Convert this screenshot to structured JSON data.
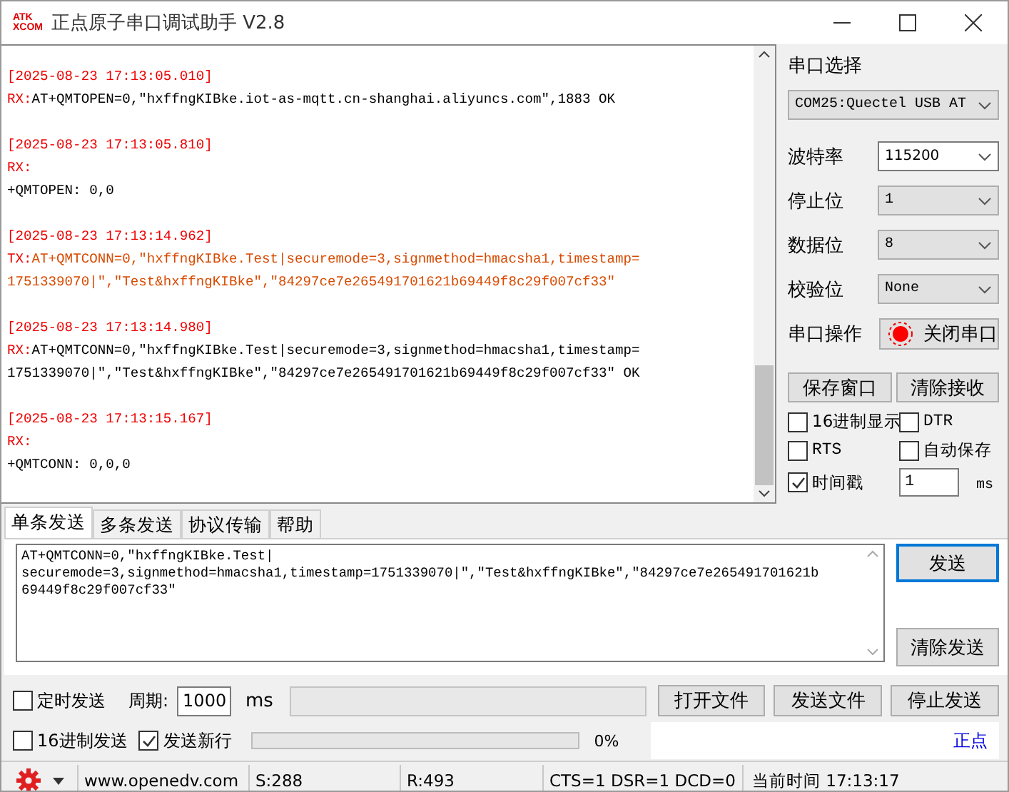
{
  "window": {
    "title": "正点原子串口调试助手 V2.8",
    "logo": [
      "ATK",
      "XCOM"
    ]
  },
  "log": [
    {
      "kind": "rx",
      "timestamp": "[2025-08-23 17:13:05.010]",
      "prefix": "RX:",
      "inline": "AT+QMTOPEN=0,\"hxffngKIBke.iot-as-mqtt.cn-shanghai.aliyuncs.com\",1883 OK"
    },
    {
      "kind": "rx",
      "timestamp": "[2025-08-23 17:13:05.810]",
      "prefix": "RX:",
      "lines": [
        "+QMTOPEN: 0,0"
      ]
    },
    {
      "kind": "tx",
      "timestamp": "[2025-08-23 17:13:14.962]",
      "prefix": "TX:",
      "inline": "AT+QMTCONN=0,\"hxffngKIBke.Test|securemode=3,signmethod=hmacsha1,timestamp=",
      "lines": [
        "1751339070|\",\"Test&hxffngKIBke\",\"84297ce7e265491701621b69449f8c29f007cf33\""
      ]
    },
    {
      "kind": "rx",
      "timestamp": "[2025-08-23 17:13:14.980]",
      "prefix": "RX:",
      "inline": "AT+QMTCONN=0,\"hxffngKIBke.Test|securemode=3,signmethod=hmacsha1,timestamp=",
      "lines": [
        "1751339070|\",\"Test&hxffngKIBke\",\"84297ce7e265491701621b69449f8c29f007cf33\" OK"
      ]
    },
    {
      "kind": "rx",
      "timestamp": "[2025-08-23 17:13:15.167]",
      "prefix": "RX:",
      "lines": [
        "+QMTCONN: 0,0,0"
      ]
    }
  ],
  "port_panel": {
    "title": "串口选择",
    "port": "COM25:Quectel USB AT",
    "settings": [
      {
        "label": "波特率",
        "value": "115200",
        "kind": "editable"
      },
      {
        "label": "停止位",
        "value": "1",
        "kind": "list"
      },
      {
        "label": "数据位",
        "value": "8",
        "kind": "list"
      },
      {
        "label": "校验位",
        "value": "None",
        "kind": "list"
      }
    ],
    "operation_label": "串口操作",
    "toggle_button": "关闭串口",
    "port_open": true,
    "buttons": [
      "保存窗口",
      "清除接收"
    ],
    "options": [
      {
        "label": "16进制显示",
        "checked": false
      },
      {
        "label": "DTR",
        "checked": false
      },
      {
        "label": "RTS",
        "checked": false
      },
      {
        "label": "自动保存",
        "checked": false
      },
      {
        "label": "时间戳",
        "checked": true
      }
    ],
    "interval": {
      "value": "1",
      "unit": "ms"
    }
  },
  "tabs": [
    {
      "label": "单条发送",
      "selected": true
    },
    {
      "label": "多条发送",
      "selected": false
    },
    {
      "label": "协议传输",
      "selected": false
    },
    {
      "label": "帮助",
      "selected": false
    }
  ],
  "send_box": {
    "lines": [
      "AT+QMTCONN=0,\"hxffngKIBke.Test|",
      "securemode=3,signmethod=hmacsha1,timestamp=1751339070|\",\"Test&hxffngKIBke\",\"84297ce7e265491701621b",
      "69449f8c29f007cf33\""
    ]
  },
  "send_buttons": [
    "发送",
    "清除发送"
  ],
  "timed_send": {
    "label": "定时发送",
    "checked": false
  },
  "period": {
    "label": "周期:",
    "value": "1000",
    "unit": "ms"
  },
  "file_buttons": [
    "打开文件",
    "发送文件",
    "停止发送"
  ],
  "hex_send": {
    "label": "16进制发送",
    "checked": false
  },
  "newline": {
    "label": "发送新行",
    "checked": true
  },
  "progress": {
    "level": 0,
    "reading": "0%"
  },
  "link": "正点",
  "status_bar": {
    "url": "www.openedv.com",
    "sent": "S:288",
    "received": "R:493",
    "lines": "CTS=1 DSR=1 DCD=0",
    "time": "当前时间 17:13:17"
  }
}
